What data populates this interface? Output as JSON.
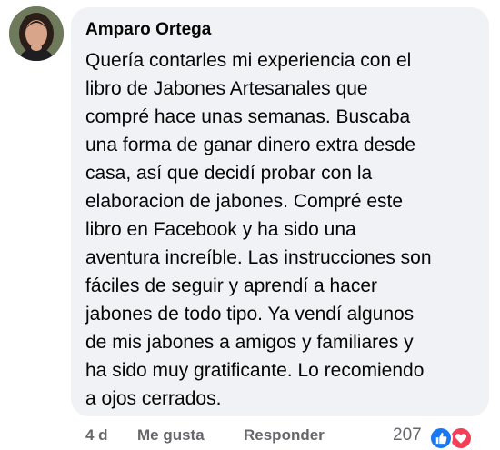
{
  "comment": {
    "author": "Amparo Ortega",
    "text": "Quería contarles mi experiencia con el\nlibro de Jabones Artesanales que\ncompré hace unas semanas. Buscaba\nuna forma de ganar dinero extra desde\ncasa, así que decidí probar con la\nelaboracion de jabones. Compré este\nlibro en Facebook y ha sido una\naventura increíble. Las instrucciones son\nfáciles de seguir y aprendí a hacer\njabones de todo tipo. Ya vendí algunos\nde mis jabones a amigos y familiares y\nha sido muy gratificante. Lo recomiendo\na ojos cerrados."
  },
  "actions": {
    "time": "4 d",
    "like_label": "Me gusta",
    "reply_label": "Responder"
  },
  "reactions": {
    "count": "207",
    "icons": [
      "thumbs-up-icon",
      "heart-icon"
    ],
    "colors": {
      "like": "#1877f2",
      "love": "#f33e58"
    }
  },
  "colors": {
    "bubble": "#f0f2f5",
    "text": "#050505",
    "muted": "#65676b"
  }
}
